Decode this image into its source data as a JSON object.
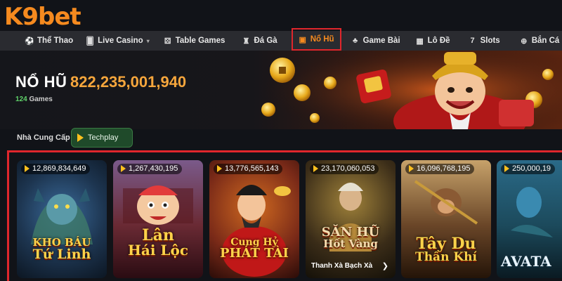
{
  "brand": {
    "logo_text": "K9bet"
  },
  "nav": {
    "items": [
      {
        "label": "Thể Thao",
        "icon": "soccer-ball-icon"
      },
      {
        "label": "Live Casino",
        "icon": "cards-icon"
      },
      {
        "label": "Table Games",
        "icon": "dice-icon"
      },
      {
        "label": "Đá Gà",
        "icon": "rooster-icon"
      },
      {
        "label": "Nổ Hũ",
        "icon": "jackpot-pot-icon",
        "active": true
      },
      {
        "label": "Game Bài",
        "icon": "club-icon"
      },
      {
        "label": "Lô Đề",
        "icon": "lottery-icon"
      },
      {
        "label": "Slots",
        "icon": "seven-icon"
      },
      {
        "label": "Bắn Cá",
        "icon": "crosshair-icon"
      }
    ]
  },
  "page": {
    "title": "NỔ HŨ",
    "jackpot": "822,235,001,940",
    "games_count": "124",
    "games_suffix": "Games"
  },
  "provider": {
    "label": "Nhà Cung Cấp",
    "button": "Techplay"
  },
  "games": [
    {
      "jackpot": "12,869,834,649",
      "title_line1": "KHO BÁU",
      "title_line2": "Tứ Linh",
      "color": "#1d3550"
    },
    {
      "jackpot": "1,267,430,195",
      "title_line1": "Lân",
      "title_line2": "Hái Lộc",
      "color": "#6a2a34"
    },
    {
      "jackpot": "13,776,565,143",
      "title_line1": "Cung Hỷ",
      "title_line2": "PHÁT TÀI",
      "color": "#7a2a18"
    },
    {
      "jackpot": "23,170,060,053",
      "title_line1": "SĂN HŨ",
      "title_line2": "Hốt Vàng",
      "subtitle": "Thanh Xà Bạch Xà",
      "color": "#3a2c18"
    },
    {
      "jackpot": "16,096,768,195",
      "title_line1": "Tây Du",
      "title_line2": "Thần Khí",
      "color": "#4a3020"
    },
    {
      "jackpot": "250,000,19",
      "title_line1": "AVATA",
      "title_line2": "",
      "color": "#1c4a5c"
    }
  ],
  "colors": {
    "accent": "#f58a1f",
    "highlight": "#e0262c",
    "jackpot": "#f6a63c",
    "count": "#5fd36a"
  }
}
